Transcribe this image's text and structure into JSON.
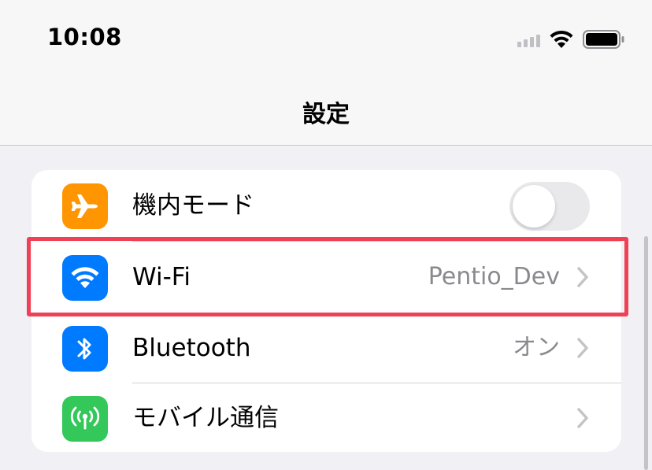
{
  "status_bar": {
    "time": "10:08",
    "signal_icon": "cellular-signal-icon",
    "wifi_icon": "wifi-icon",
    "battery_icon": "battery-icon"
  },
  "nav": {
    "title": "設定"
  },
  "settings": {
    "rows": [
      {
        "label": "機内モード",
        "icon": "airplane-icon",
        "icon_color": "#ff9500",
        "toggle_on": false
      },
      {
        "label": "Wi-Fi",
        "icon": "wifi-icon",
        "icon_color": "#007aff",
        "value": "Pentio_Dev"
      },
      {
        "label": "Bluetooth",
        "icon": "bluetooth-icon",
        "icon_color": "#007aff",
        "value": "オン"
      },
      {
        "label": "モバイル通信",
        "icon": "antenna-icon",
        "icon_color": "#34c759",
        "value": ""
      }
    ]
  },
  "colors": {
    "highlight": "#ef4056",
    "background": "#f0f0f5"
  }
}
